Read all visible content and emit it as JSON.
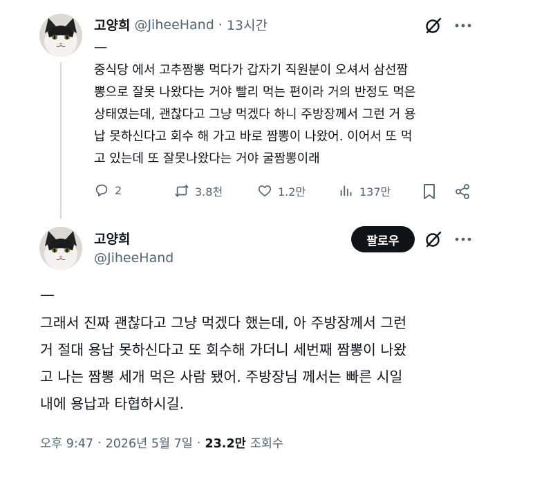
{
  "tweet1": {
    "display_name": "고양희",
    "handle": "@JiheeHand",
    "separator": "·",
    "time": "13시간",
    "dash": "—",
    "body_lines": [
      "중식당 에서 고추짬뽕 먹다가 갑자기 직원분이 오셔서 삼선짬",
      "뽕으로 잘못 나왔다는 거야 빨리 먹는 편이라 거의 반정도 먹은",
      "상태였는데, 괜찮다고 그냥 먹겠다 하니 주방장께서 그런 거 용",
      "납 못하신다고 회수 해 가고 바로 짬뽕이 나왔어. 이어서 또 먹",
      "고 있는데 또 잘못나왔다는 거야 굴짬뽕이래"
    ],
    "actions": {
      "replies": "2",
      "reposts": "3.8천",
      "likes": "1.2만",
      "views": "137만"
    }
  },
  "tweet2": {
    "display_name": "고양희",
    "handle": "@JiheeHand",
    "follow_label": "팔로우",
    "dash": "—",
    "body_lines": [
      "그래서 진짜 괜찮다고 그냥 먹겠다 했는데, 아 주방장께서 그런",
      "거 절대 용납 못하신다고 또 회수해 가더니 세번째 짬뽕이 나왔",
      "고 나는 짬뽕 세개 먹은 사람 됐어. 주방장님 께서는 빠른 시일",
      "내에 용납과 타협하시길."
    ],
    "meta": {
      "time": "오후 9:47",
      "sep1": "·",
      "date": "2026년 5월 7일",
      "sep2": "·",
      "views_count": "23.2만",
      "views_label": "조회수"
    }
  },
  "icons": {
    "grok": "grok-icon",
    "more": "more-icon",
    "reply": "reply-icon",
    "repost": "repost-icon",
    "like": "like-icon",
    "views": "views-icon",
    "bookmark": "bookmark-icon",
    "share": "share-icon"
  },
  "colors": {
    "text": "#0f1419",
    "secondary": "#536471",
    "thread_line": "#cfd9de",
    "follow_bg": "#0f1419"
  }
}
